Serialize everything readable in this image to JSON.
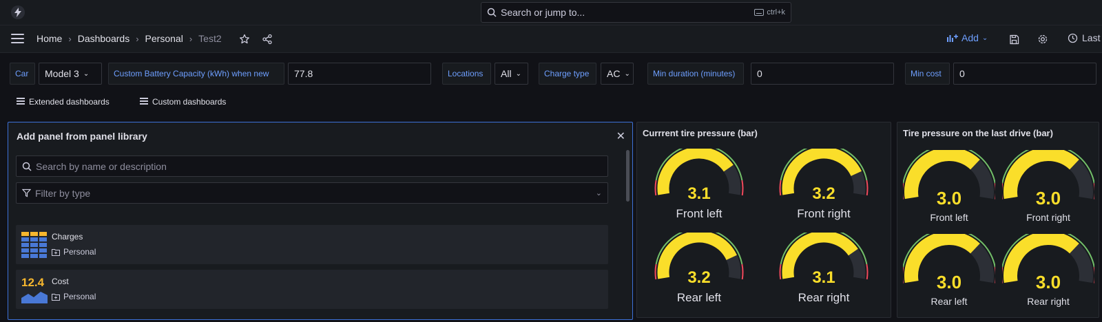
{
  "topbar": {
    "search_placeholder": "Search or jump to...",
    "shortcut": "ctrl+k"
  },
  "nav": {
    "breadcrumbs": [
      "Home",
      "Dashboards",
      "Personal",
      "Test2"
    ],
    "add_label": "Add",
    "time_label": "Last"
  },
  "variables": {
    "car_label": "Car",
    "car_value": "Model 3",
    "battery_label": "Custom Battery Capacity (kWh) when new",
    "battery_value": "77.8",
    "locations_label": "Locations",
    "locations_value": "All",
    "charge_type_label": "Charge type",
    "charge_type_value": "AC",
    "min_duration_label": "Min duration (minutes)",
    "min_duration_value": "0",
    "min_cost_label": "Min cost",
    "min_cost_value": "0"
  },
  "dashboard_links": [
    "Extended dashboards",
    "Custom dashboards"
  ],
  "library": {
    "title": "Add panel from panel library",
    "search_placeholder": "Search by name or description",
    "filter_placeholder": "Filter by type",
    "items": [
      {
        "name": "Charges",
        "folder": "Personal",
        "icon": "table-icon"
      },
      {
        "name": "Cost",
        "folder": "Personal",
        "icon": "stat-icon",
        "stat_preview": "12.4"
      }
    ]
  },
  "current_pressure": {
    "title": "Currrent tire pressure (bar)",
    "gauges": [
      {
        "label": "Front left",
        "value": "3.1",
        "fill": 0.78
      },
      {
        "label": "Front right",
        "value": "3.2",
        "fill": 0.83
      },
      {
        "label": "Rear left",
        "value": "3.2",
        "fill": 0.83
      },
      {
        "label": "Rear right",
        "value": "3.1",
        "fill": 0.78
      }
    ]
  },
  "last_drive_pressure": {
    "title": "Tire pressure on the last drive (bar)",
    "gauges": [
      {
        "label": "Front left",
        "value": "3.0",
        "fill": 0.72
      },
      {
        "label": "Front right",
        "value": "3.0",
        "fill": 0.72
      },
      {
        "label": "Rear left",
        "value": "3.0",
        "fill": 0.72
      },
      {
        "label": "Rear right",
        "value": "3.0",
        "fill": 0.72
      }
    ]
  },
  "colors": {
    "accent": "#6e9fff",
    "gauge_fill": "#fade2a",
    "gauge_track": "#2c2f36",
    "threshold_green": "#73bf69",
    "threshold_red": "#f2495c",
    "selection_border": "#3d71d9"
  }
}
